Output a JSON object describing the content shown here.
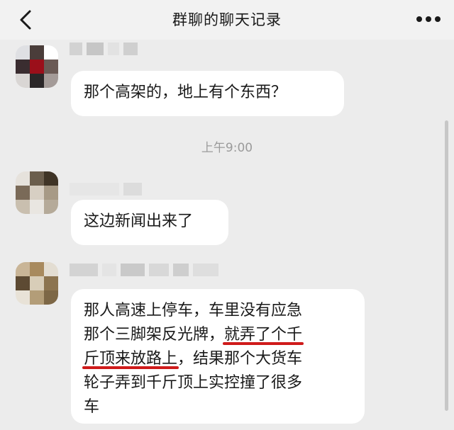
{
  "header": {
    "title": "群聊的聊天记录",
    "back_icon": "chevron-left-icon",
    "more_icon": "more-dots-icon"
  },
  "chat": {
    "timestamp": "上午9:00",
    "messages": [
      {
        "lines": [
          "那个高架的，地上有个东西？"
        ]
      },
      {
        "lines": [
          "这边新闻出来了"
        ]
      },
      {
        "lines": [
          {
            "plain": "那人高速上停车，车里没有应急"
          },
          {
            "plain": "那个三脚架反光牌，",
            "underlined": "就弄了个千"
          },
          {
            "underlined": "斤顶来放路上",
            "plain": "，结果那个大货车"
          },
          {
            "plain": "轮子弄到千斤顶上实控撞了很多"
          },
          {
            "plain": "车"
          }
        ]
      }
    ]
  },
  "colors": {
    "background": "#ececec",
    "bubble": "#ffffff",
    "underline": "#cf1b1b",
    "timestamp_text": "#9b9b9b"
  }
}
